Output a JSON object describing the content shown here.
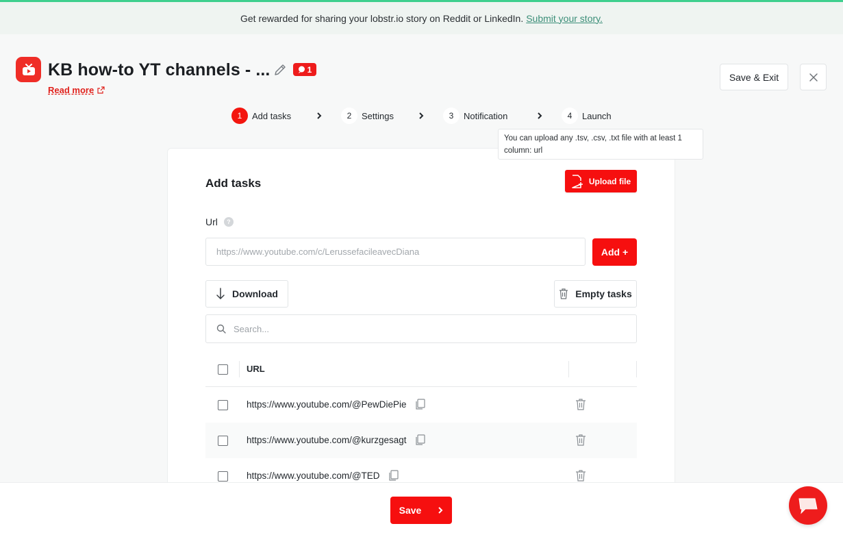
{
  "banner": {
    "text": "Get rewarded for sharing your lobstr.io story on Reddit or LinkedIn.",
    "link": "Submit your story."
  },
  "header": {
    "title": "KB how-to YT channels - ...",
    "badge_count": "1",
    "read_more": "Read more",
    "save_exit": "Save & Exit"
  },
  "steps": [
    {
      "num": "1",
      "label": "Add tasks"
    },
    {
      "num": "2",
      "label": "Settings"
    },
    {
      "num": "3",
      "label": "Notification"
    },
    {
      "num": "4",
      "label": "Launch"
    }
  ],
  "tooltip": "You can upload any .tsv, .csv, .txt file with at least 1 column: url",
  "card": {
    "title": "Add tasks",
    "upload_label": "Upload file",
    "url_label": "Url",
    "url_placeholder": "https://www.youtube.com/c/LerussefacileavecDiana",
    "add_label": "Add +",
    "download_label": "Download",
    "empty_label": "Empty tasks",
    "search_placeholder": "Search...",
    "column_url": "URL",
    "rows": [
      "https://www.youtube.com/@PewDiePie",
      "https://www.youtube.com/@kurzgesagt",
      "https://www.youtube.com/@TED"
    ]
  },
  "footer": {
    "save_label": "Save"
  },
  "colors": {
    "accent": "#f60f0f",
    "banner_bg": "#eff4f1",
    "banner_border": "#3fcf8e",
    "link": "#3b8e78"
  }
}
